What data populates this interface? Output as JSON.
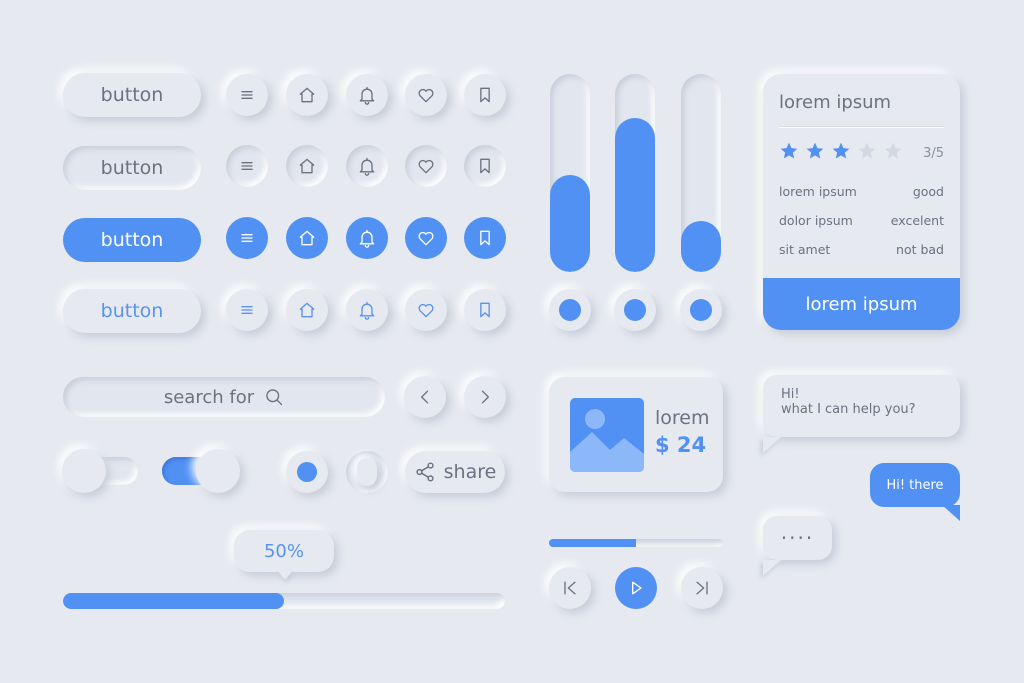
{
  "buttons": {
    "labels": [
      "button",
      "button",
      "button",
      "button"
    ]
  },
  "icon_rows": [
    [
      "menu-icon",
      "home-icon",
      "bell-icon",
      "heart-icon",
      "bookmark-icon"
    ],
    [
      "menu-icon",
      "home-icon",
      "bell-icon",
      "heart-icon",
      "bookmark-icon"
    ],
    [
      "menu-icon",
      "home-icon",
      "bell-icon",
      "heart-icon",
      "bookmark-icon"
    ],
    [
      "menu-icon",
      "home-icon",
      "bell-icon",
      "heart-icon",
      "bookmark-icon"
    ]
  ],
  "vertical_sliders": [
    {
      "level": 0.49
    },
    {
      "level": 0.78
    },
    {
      "level": 0.26
    }
  ],
  "rating_card": {
    "title": "lorem ipsum",
    "stars_filled": 3,
    "stars_total": 5,
    "score": "3/5",
    "rows": [
      {
        "label": "lorem ipsum",
        "value": "good"
      },
      {
        "label": "dolor ipsum",
        "value": "excelent"
      },
      {
        "label": "sit amet",
        "value": "not bad"
      }
    ],
    "button_label": "lorem ipsum"
  },
  "search": {
    "placeholder": "search for",
    "icon": "search-icon"
  },
  "pager": {
    "prev_icon": "chevron-left-icon",
    "next_icon": "chevron-right-icon"
  },
  "share": {
    "label": "share",
    "icon": "share-icon"
  },
  "toggles": [
    {
      "state": "off"
    },
    {
      "state": "on"
    }
  ],
  "radios": [
    {
      "state": "selected"
    },
    {
      "state": "unselected"
    }
  ],
  "progress": {
    "label": "50%",
    "value": 0.5
  },
  "product_card": {
    "name": "lorem",
    "price": "$ 24",
    "image_icon": "image-icon"
  },
  "media_player": {
    "progress": 0.5,
    "prev_icon": "skip-back-icon",
    "play_icon": "play-icon",
    "next_icon": "skip-forward-icon"
  },
  "chat": {
    "incoming_line1": "Hi!",
    "incoming_line2": "what I can help you?",
    "outgoing": "Hi! there",
    "typing": "····"
  },
  "colors": {
    "background": "#e6e9f0",
    "accent": "#5191f4",
    "text": "#6b7280",
    "star_empty": "#d3d8e2"
  }
}
